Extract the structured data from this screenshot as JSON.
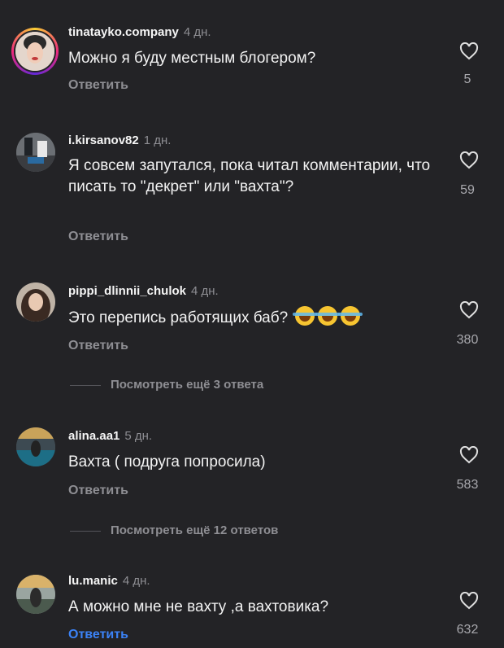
{
  "comments": [
    {
      "username": "tinatayko.company",
      "time": "4 дн.",
      "text": "Можно я буду местным блогером?",
      "reply": "Ответить",
      "likes": "5"
    },
    {
      "username": "i.kirsanov82",
      "time": "1 дн.",
      "text": "Я совсем запутался, пока читал комментарии, что писать то \"декрет\" или \"вахта\"?",
      "reply": "Ответить",
      "likes": "59"
    },
    {
      "username": "pippi_dlinnii_chulok",
      "time": "4 дн.",
      "text": "Это перепись работящих баб?",
      "reply": "Ответить",
      "likes": "380"
    },
    {
      "username": "alina.aa1",
      "time": "5 дн.",
      "text": "Вахта ( подруга попросила)",
      "reply": "Ответить",
      "likes": "583"
    },
    {
      "username": "lu.manic",
      "time": "4 дн.",
      "text": "А можно мне не вахту ,а вахтовика?",
      "reply": "Ответить",
      "likes": "632"
    }
  ],
  "view_more": [
    {
      "label": "Посмотреть ещё 3 ответа"
    },
    {
      "label": "Посмотреть ещё 12 ответов"
    }
  ],
  "icons": {
    "like": "heart-outline-icon",
    "emoji": "laughing-tears-emoji"
  },
  "colors": {
    "background": "#232326",
    "reply_active": "#3b82f6",
    "muted": "#8e8e93"
  }
}
